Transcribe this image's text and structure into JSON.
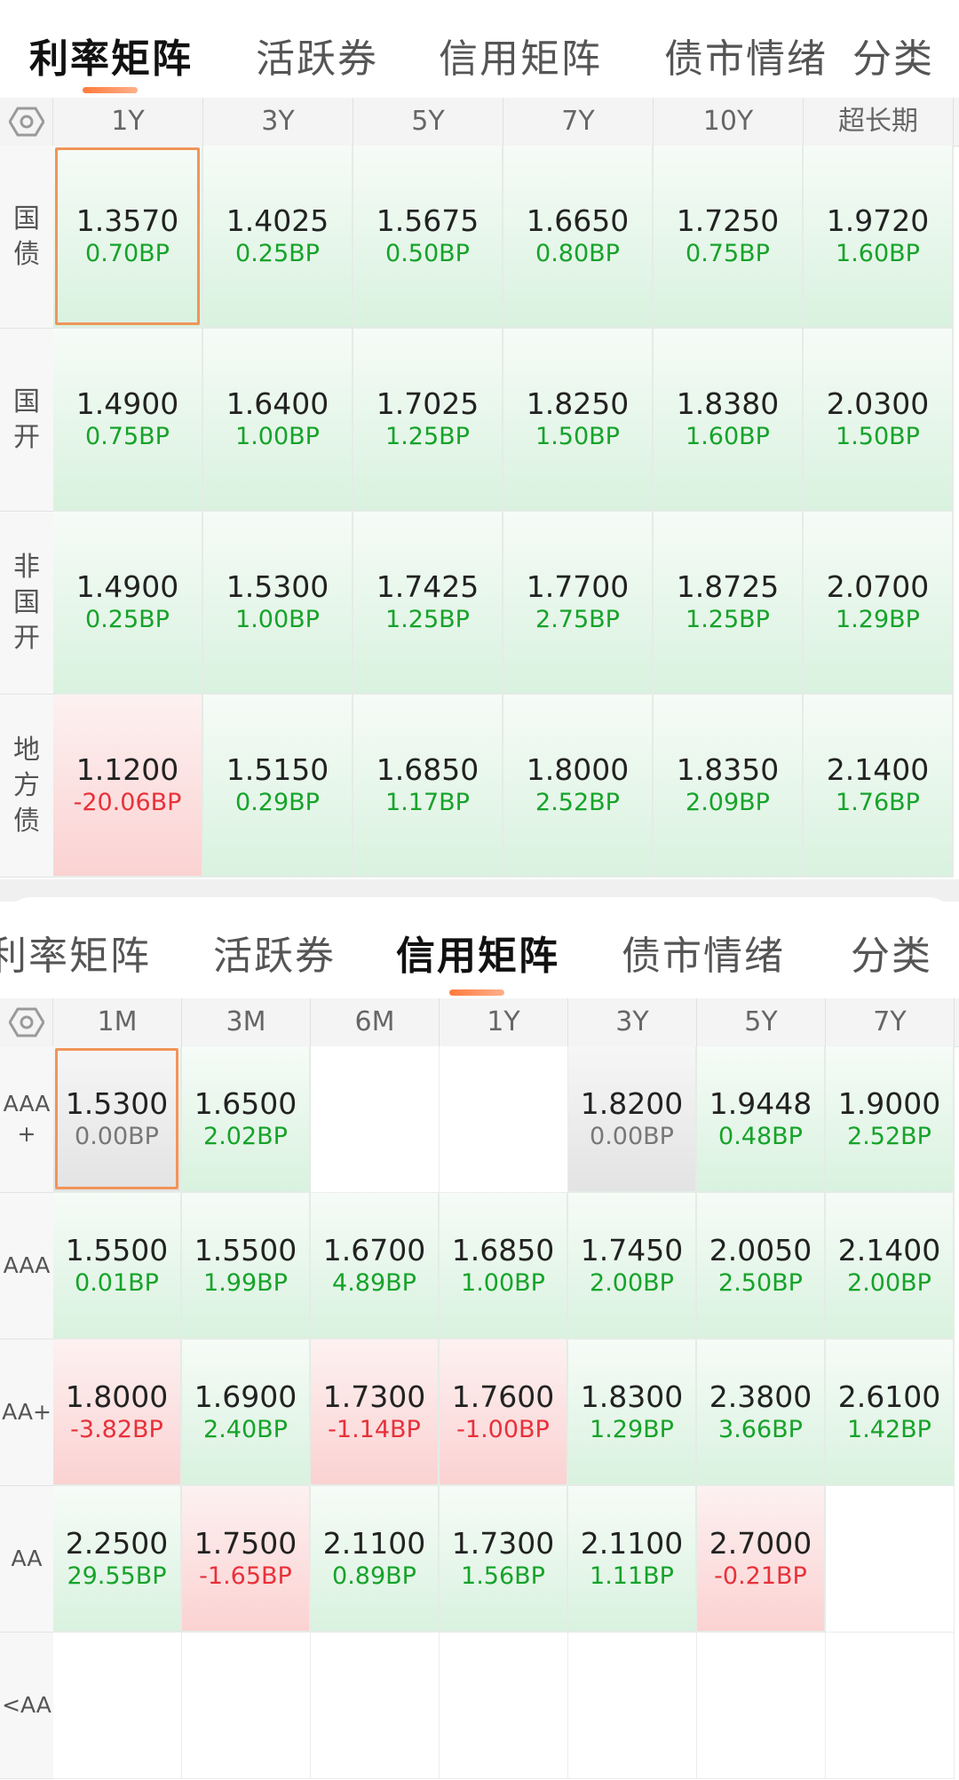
{
  "rate_matrix": {
    "tabs": [
      {
        "label": "利率矩阵",
        "active": true
      },
      {
        "label": "活跃券",
        "active": false
      },
      {
        "label": "信用矩阵",
        "active": false
      },
      {
        "label": "债市情绪",
        "active": false
      },
      {
        "label": "分类",
        "active": false
      }
    ],
    "columns": [
      "1Y",
      "3Y",
      "5Y",
      "7Y",
      "10Y",
      "超长期"
    ],
    "rows": [
      {
        "label": "国债",
        "cells": [
          {
            "value": "1.3570",
            "change": "0.70BP",
            "tone": "green",
            "selected": true
          },
          {
            "value": "1.4025",
            "change": "0.25BP",
            "tone": "green"
          },
          {
            "value": "1.5675",
            "change": "0.50BP",
            "tone": "green"
          },
          {
            "value": "1.6650",
            "change": "0.80BP",
            "tone": "green"
          },
          {
            "value": "1.7250",
            "change": "0.75BP",
            "tone": "green"
          },
          {
            "value": "1.9720",
            "change": "1.60BP",
            "tone": "green"
          }
        ]
      },
      {
        "label": "国开",
        "cells": [
          {
            "value": "1.4900",
            "change": "0.75BP",
            "tone": "green"
          },
          {
            "value": "1.6400",
            "change": "1.00BP",
            "tone": "green"
          },
          {
            "value": "1.7025",
            "change": "1.25BP",
            "tone": "green"
          },
          {
            "value": "1.8250",
            "change": "1.50BP",
            "tone": "green"
          },
          {
            "value": "1.8380",
            "change": "1.60BP",
            "tone": "green"
          },
          {
            "value": "2.0300",
            "change": "1.50BP",
            "tone": "green"
          }
        ]
      },
      {
        "label": "非国开",
        "cells": [
          {
            "value": "1.4900",
            "change": "0.25BP",
            "tone": "green"
          },
          {
            "value": "1.5300",
            "change": "1.00BP",
            "tone": "green"
          },
          {
            "value": "1.7425",
            "change": "1.25BP",
            "tone": "green"
          },
          {
            "value": "1.7700",
            "change": "2.75BP",
            "tone": "green"
          },
          {
            "value": "1.8725",
            "change": "1.25BP",
            "tone": "green"
          },
          {
            "value": "2.0700",
            "change": "1.29BP",
            "tone": "green"
          }
        ]
      },
      {
        "label": "地方债",
        "cells": [
          {
            "value": "1.1200",
            "change": "-20.06BP",
            "tone": "red"
          },
          {
            "value": "1.5150",
            "change": "0.29BP",
            "tone": "green"
          },
          {
            "value": "1.6850",
            "change": "1.17BP",
            "tone": "green"
          },
          {
            "value": "1.8000",
            "change": "2.52BP",
            "tone": "green"
          },
          {
            "value": "1.8350",
            "change": "2.09BP",
            "tone": "green"
          },
          {
            "value": "2.1400",
            "change": "1.76BP",
            "tone": "green"
          }
        ]
      }
    ]
  },
  "credit_matrix": {
    "tabs": [
      {
        "label": "利率矩阵",
        "active": false
      },
      {
        "label": "活跃券",
        "active": false
      },
      {
        "label": "信用矩阵",
        "active": true
      },
      {
        "label": "债市情绪",
        "active": false
      },
      {
        "label": "分类",
        "active": false
      }
    ],
    "columns": [
      "1M",
      "3M",
      "6M",
      "1Y",
      "3Y",
      "5Y",
      "7Y"
    ],
    "rows": [
      {
        "label": "AAA+",
        "cells": [
          {
            "value": "1.5300",
            "change": "0.00BP",
            "tone": "gray",
            "selected": true
          },
          {
            "value": "1.6500",
            "change": "2.02BP",
            "tone": "green"
          },
          {
            "value": "",
            "change": "",
            "tone": "empty"
          },
          {
            "value": "",
            "change": "",
            "tone": "empty"
          },
          {
            "value": "1.8200",
            "change": "0.00BP",
            "tone": "gray"
          },
          {
            "value": "1.9448",
            "change": "0.48BP",
            "tone": "green"
          },
          {
            "value": "1.9000",
            "change": "2.52BP",
            "tone": "green"
          }
        ]
      },
      {
        "label": "AAA",
        "cells": [
          {
            "value": "1.5500",
            "change": "0.01BP",
            "tone": "green"
          },
          {
            "value": "1.5500",
            "change": "1.99BP",
            "tone": "green"
          },
          {
            "value": "1.6700",
            "change": "4.89BP",
            "tone": "green"
          },
          {
            "value": "1.6850",
            "change": "1.00BP",
            "tone": "green"
          },
          {
            "value": "1.7450",
            "change": "2.00BP",
            "tone": "green"
          },
          {
            "value": "2.0050",
            "change": "2.50BP",
            "tone": "green"
          },
          {
            "value": "2.1400",
            "change": "2.00BP",
            "tone": "green"
          }
        ]
      },
      {
        "label": "AA+",
        "cells": [
          {
            "value": "1.8000",
            "change": "-3.82BP",
            "tone": "red"
          },
          {
            "value": "1.6900",
            "change": "2.40BP",
            "tone": "green"
          },
          {
            "value": "1.7300",
            "change": "-1.14BP",
            "tone": "red"
          },
          {
            "value": "1.7600",
            "change": "-1.00BP",
            "tone": "red"
          },
          {
            "value": "1.8300",
            "change": "1.29BP",
            "tone": "green"
          },
          {
            "value": "2.3800",
            "change": "3.66BP",
            "tone": "green"
          },
          {
            "value": "2.6100",
            "change": "1.42BP",
            "tone": "green"
          }
        ]
      },
      {
        "label": "AA",
        "cells": [
          {
            "value": "2.2500",
            "change": "29.55BP",
            "tone": "green"
          },
          {
            "value": "1.7500",
            "change": "-1.65BP",
            "tone": "red"
          },
          {
            "value": "2.1100",
            "change": "0.89BP",
            "tone": "green"
          },
          {
            "value": "1.7300",
            "change": "1.56BP",
            "tone": "green"
          },
          {
            "value": "2.1100",
            "change": "1.11BP",
            "tone": "green"
          },
          {
            "value": "2.7000",
            "change": "-0.21BP",
            "tone": "red"
          },
          {
            "value": "",
            "change": "",
            "tone": "empty"
          }
        ]
      },
      {
        "label": "<AA",
        "cells": [
          {
            "value": "",
            "change": "",
            "tone": "empty"
          },
          {
            "value": "",
            "change": "",
            "tone": "empty"
          },
          {
            "value": "",
            "change": "",
            "tone": "empty"
          },
          {
            "value": "",
            "change": "",
            "tone": "empty"
          },
          {
            "value": "",
            "change": "",
            "tone": "empty"
          },
          {
            "value": "",
            "change": "",
            "tone": "empty"
          },
          {
            "value": "",
            "change": "",
            "tone": "empty"
          }
        ]
      }
    ]
  }
}
